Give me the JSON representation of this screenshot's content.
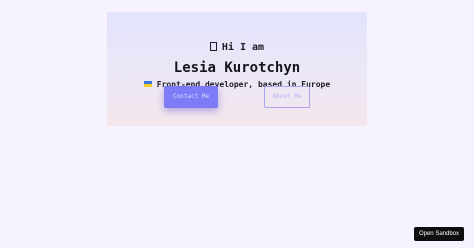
{
  "hero": {
    "greeting_icon": "emoji-placeholder-icon",
    "greeting": "Hi I am",
    "name": "Lesia Kurotchyn",
    "flag_icon": "ukraine-flag-icon",
    "tagline": "Front-end developer, based in Europe",
    "contact_button": "Contact Me",
    "about_button": "About Me"
  },
  "sandbox": {
    "open_label": "Open Sandbox"
  },
  "colors": {
    "page_background": "#f6f3fe",
    "accent": "#7d7bf6",
    "text": "#1c1c24",
    "sandbox_button": "#0f0f12"
  }
}
